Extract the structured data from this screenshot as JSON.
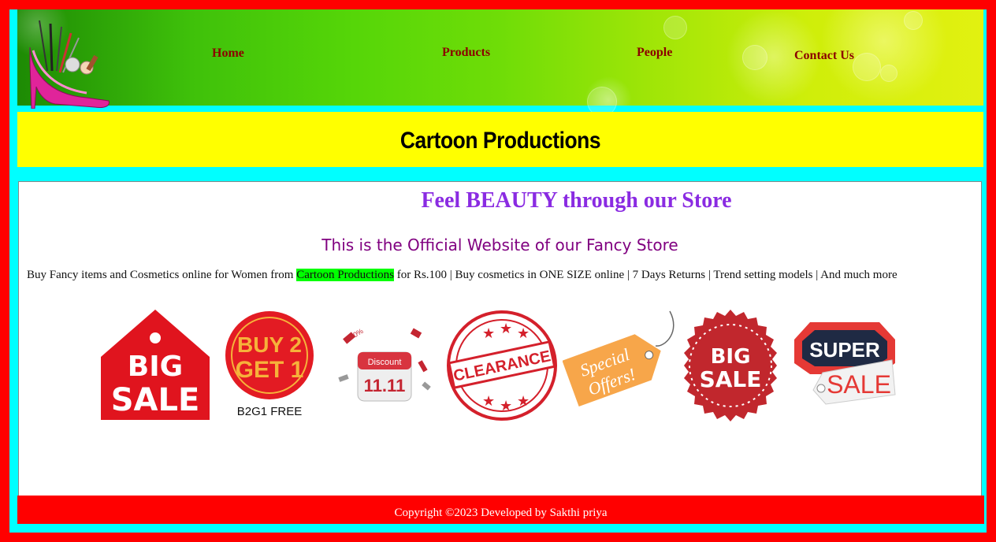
{
  "nav": {
    "home": "Home",
    "products": "Products",
    "people": "People",
    "contact": "Contact Us"
  },
  "brand": {
    "title": "Cartoon Productions"
  },
  "main": {
    "tagline": "Feel BEAUTY through our Store",
    "subtitle": "This is the Official Website of our Fancy Store",
    "desc_before": "Buy Fancy items and Cosmetics online for Women from ",
    "desc_highlight": "Cartoon Productions",
    "desc_after": " for Rs.100 | Buy cosmetics in ONE SIZE online | 7 Days Returns | Trend setting models | And much more"
  },
  "badges": {
    "big_sale_1": {
      "line1": "BIG",
      "line2": "SALE"
    },
    "buy2get1": {
      "line1": "BUY 2",
      "line2": "GET 1",
      "caption": "B2G1 FREE"
    },
    "discount": {
      "label": "Discount",
      "date": "11.11",
      "tag": "70%"
    },
    "clearance": {
      "label": "CLEARANCE"
    },
    "special": {
      "line1": "Special",
      "line2": "Offers!"
    },
    "big_sale_2": {
      "line1": "BIG",
      "line2": "SALE"
    },
    "super_sale": {
      "line1": "SUPER",
      "line2": "SALE"
    }
  },
  "colors": {
    "outer_border": "#ff0000",
    "frame": "#00ffff",
    "title_bar": "#ffff00",
    "nav_text": "#8b0000",
    "tagline": "#8a2be2",
    "subtitle": "#800080",
    "highlight": "#00ff00",
    "footer": "#ff0000"
  },
  "footer": {
    "copyright": "Copyright ©2023 Developed by Sakthi priya"
  }
}
